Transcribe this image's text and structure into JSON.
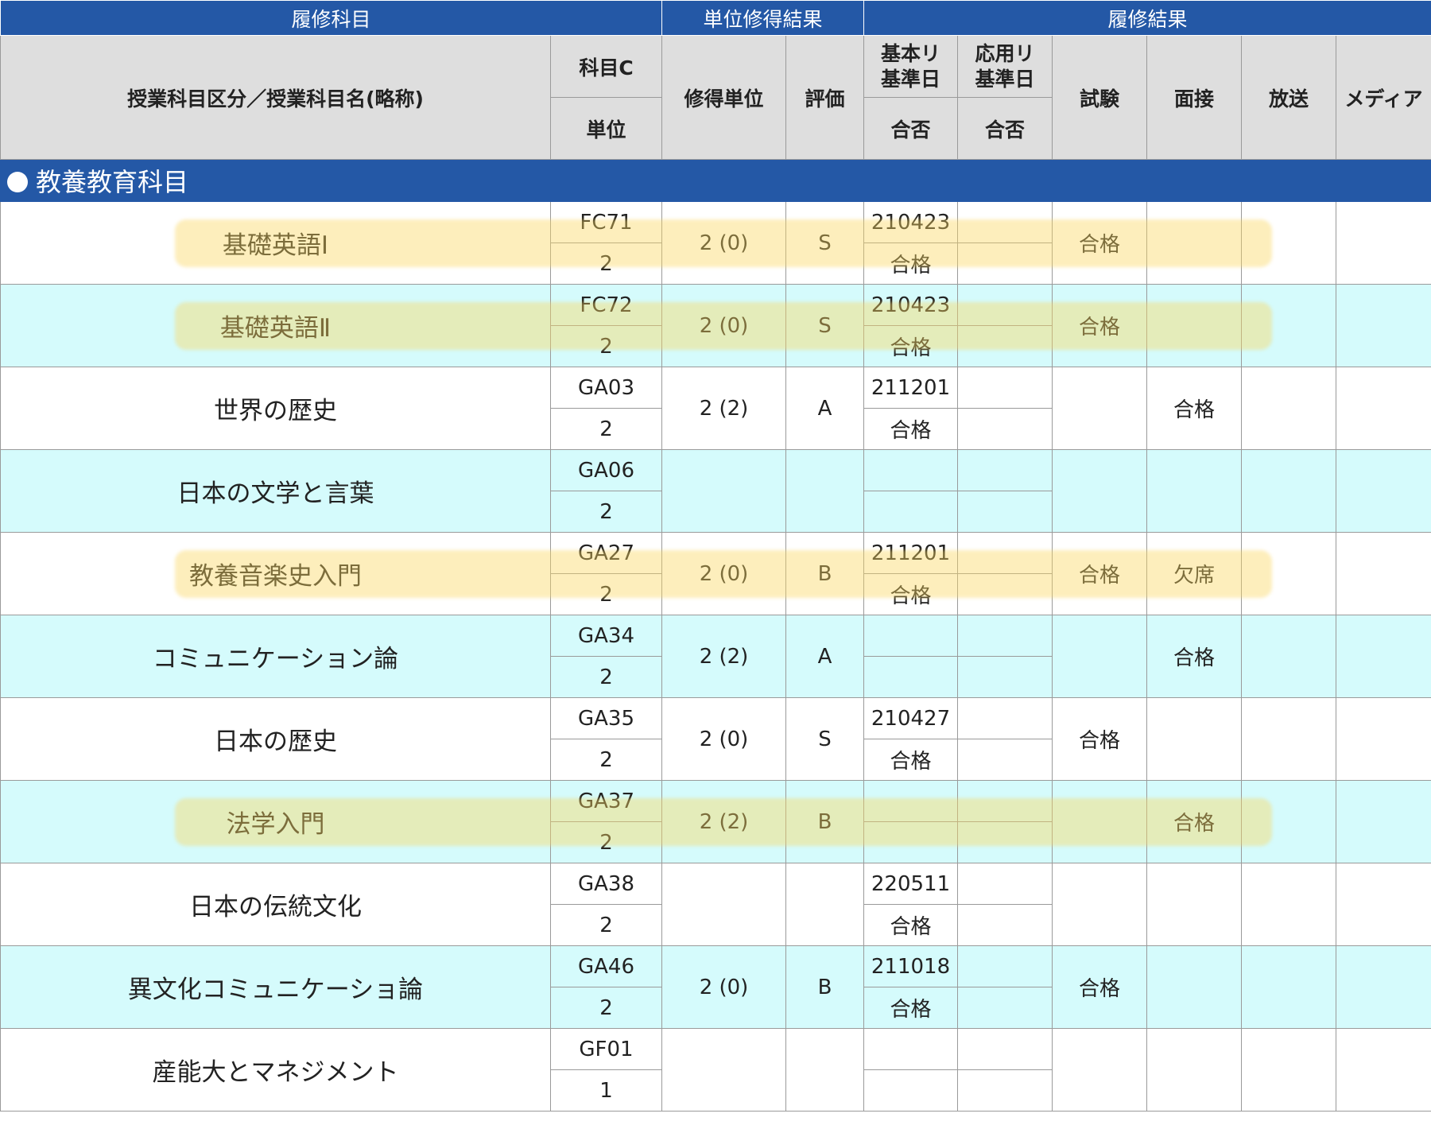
{
  "groups": {
    "courses": "履修科目",
    "credit_result": "単位修得結果",
    "enroll_result": "履修結果"
  },
  "headers": {
    "subject_name": "授業科目区分／授業科目名(略称)",
    "subject_code": "科目C",
    "units": "単位",
    "earned_units": "修得単位",
    "grade": "評価",
    "basic_report_date": "基本リ\n基準日",
    "applied_report_date": "応用リ\n基準日",
    "basic_pass": "合否",
    "applied_pass": "合否",
    "exam": "試験",
    "interview": "面接",
    "broadcast": "放送",
    "media": "メディア"
  },
  "section_title": "教養教育科目",
  "rows": [
    {
      "name": "基礎英語Ⅰ",
      "code": "FC71",
      "units": "2",
      "earned": "2 (0)",
      "grade": "S",
      "basic_date": "210423",
      "basic_pass": "合格",
      "applied_date": "",
      "applied_pass": "",
      "exam": "合格",
      "interview": "",
      "broadcast": "",
      "media": ""
    },
    {
      "name": "基礎英語Ⅱ",
      "code": "FC72",
      "units": "2",
      "earned": "2 (0)",
      "grade": "S",
      "basic_date": "210423",
      "basic_pass": "合格",
      "applied_date": "",
      "applied_pass": "",
      "exam": "合格",
      "interview": "",
      "broadcast": "",
      "media": ""
    },
    {
      "name": "世界の歴史",
      "code": "GA03",
      "units": "2",
      "earned": "2 (2)",
      "grade": "A",
      "basic_date": "211201",
      "basic_pass": "合格",
      "applied_date": "",
      "applied_pass": "",
      "exam": "",
      "interview": "合格",
      "broadcast": "",
      "media": ""
    },
    {
      "name": "日本の文学と言葉",
      "code": "GA06",
      "units": "2",
      "earned": "",
      "grade": "",
      "basic_date": "",
      "basic_pass": "",
      "applied_date": "",
      "applied_pass": "",
      "exam": "",
      "interview": "",
      "broadcast": "",
      "media": ""
    },
    {
      "name": "教養音楽史入門",
      "code": "GA27",
      "units": "2",
      "earned": "2 (0)",
      "grade": "B",
      "basic_date": "211201",
      "basic_pass": "合格",
      "applied_date": "",
      "applied_pass": "",
      "exam": "合格",
      "interview": "欠席",
      "broadcast": "",
      "media": ""
    },
    {
      "name": "コミュニケーション論",
      "code": "GA34",
      "units": "2",
      "earned": "2 (2)",
      "grade": "A",
      "basic_date": "",
      "basic_pass": "",
      "applied_date": "",
      "applied_pass": "",
      "exam": "",
      "interview": "合格",
      "broadcast": "",
      "media": ""
    },
    {
      "name": "日本の歴史",
      "code": "GA35",
      "units": "2",
      "earned": "2 (0)",
      "grade": "S",
      "basic_date": "210427",
      "basic_pass": "合格",
      "applied_date": "",
      "applied_pass": "",
      "exam": "合格",
      "interview": "",
      "broadcast": "",
      "media": ""
    },
    {
      "name": "法学入門",
      "code": "GA37",
      "units": "2",
      "earned": "2 (2)",
      "grade": "B",
      "basic_date": "",
      "basic_pass": "",
      "applied_date": "",
      "applied_pass": "",
      "exam": "",
      "interview": "合格",
      "broadcast": "",
      "media": ""
    },
    {
      "name": "日本の伝統文化",
      "code": "GA38",
      "units": "2",
      "earned": "",
      "grade": "",
      "basic_date": "220511",
      "basic_pass": "合格",
      "applied_date": "",
      "applied_pass": "",
      "exam": "",
      "interview": "",
      "broadcast": "",
      "media": ""
    },
    {
      "name": "異文化コミュニケーショ論",
      "code": "GA46",
      "units": "2",
      "earned": "2 (0)",
      "grade": "B",
      "basic_date": "211018",
      "basic_pass": "合格",
      "applied_date": "",
      "applied_pass": "",
      "exam": "合格",
      "interview": "",
      "broadcast": "",
      "media": ""
    },
    {
      "name": "産能大とマネジメント",
      "code": "GF01",
      "units": "1",
      "earned": "",
      "grade": "",
      "basic_date": "",
      "basic_pass": "",
      "applied_date": "",
      "applied_pass": "",
      "exam": "",
      "interview": "",
      "broadcast": "",
      "media": ""
    }
  ],
  "highlighted_rows": [
    0,
    1,
    4,
    7
  ],
  "colors": {
    "header_blue": "#2458a6",
    "header_gray": "#dedede",
    "row_cyan": "#d5fbfc",
    "highlight": "#fad75f"
  }
}
